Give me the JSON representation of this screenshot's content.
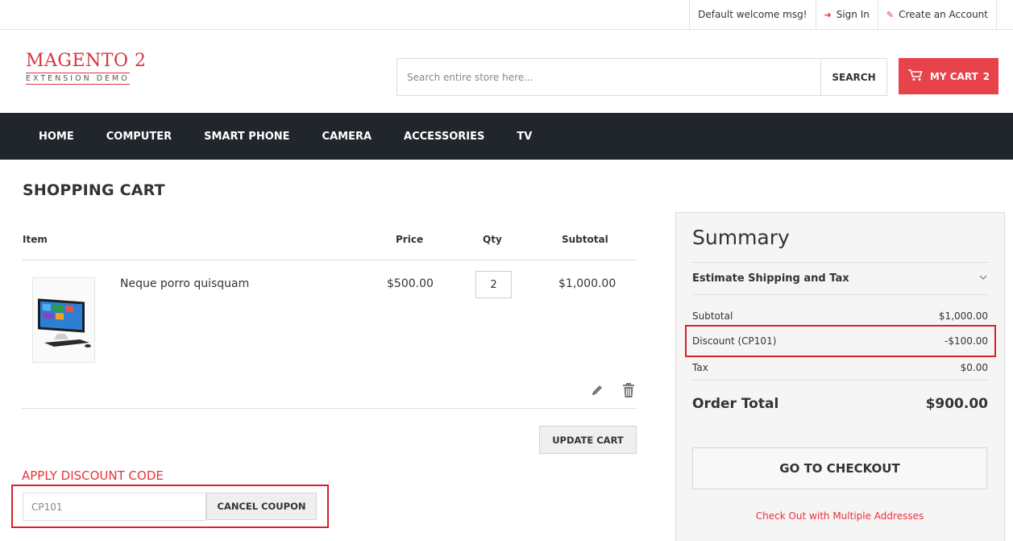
{
  "topbar": {
    "welcome": "Default welcome msg!",
    "sign_in": "Sign In",
    "create_account": "Create an Account"
  },
  "header": {
    "logo_line1": "MAGENTO 2",
    "logo_line2": "EXTENSION DEMO",
    "search_placeholder": "Search entire store here...",
    "search_button": "SEARCH",
    "cart_label": "MY CART",
    "cart_count": "2"
  },
  "nav": {
    "items": [
      "HOME",
      "COMPUTER",
      "SMART PHONE",
      "CAMERA",
      "ACCESSORIES",
      "TV"
    ]
  },
  "page_title": "SHOPPING CART",
  "cart": {
    "headers": {
      "item": "Item",
      "price": "Price",
      "qty": "Qty",
      "subtotal": "Subtotal"
    },
    "items": [
      {
        "name": "Neque porro quisquam",
        "price": "$500.00",
        "qty": "2",
        "subtotal": "$1,000.00"
      }
    ],
    "update_button": "UPDATE CART"
  },
  "discount": {
    "title": "APPLY DISCOUNT CODE",
    "code_value": "CP101",
    "cancel_button": "CANCEL COUPON"
  },
  "summary": {
    "title": "Summary",
    "estimate": "Estimate Shipping and Tax",
    "subtotal_label": "Subtotal",
    "subtotal_value": "$1,000.00",
    "discount_label": "Discount (CP101)",
    "discount_value": "-$100.00",
    "tax_label": "Tax",
    "tax_value": "$0.00",
    "order_total_label": "Order Total",
    "order_total_value": "$900.00",
    "checkout_button": "GO TO CHECKOUT",
    "multi_address": "Check Out with Multiple Addresses"
  },
  "colors": {
    "accent": "#e8424b",
    "nav_bg": "#21262c",
    "highlight_border": "#d9202a"
  }
}
